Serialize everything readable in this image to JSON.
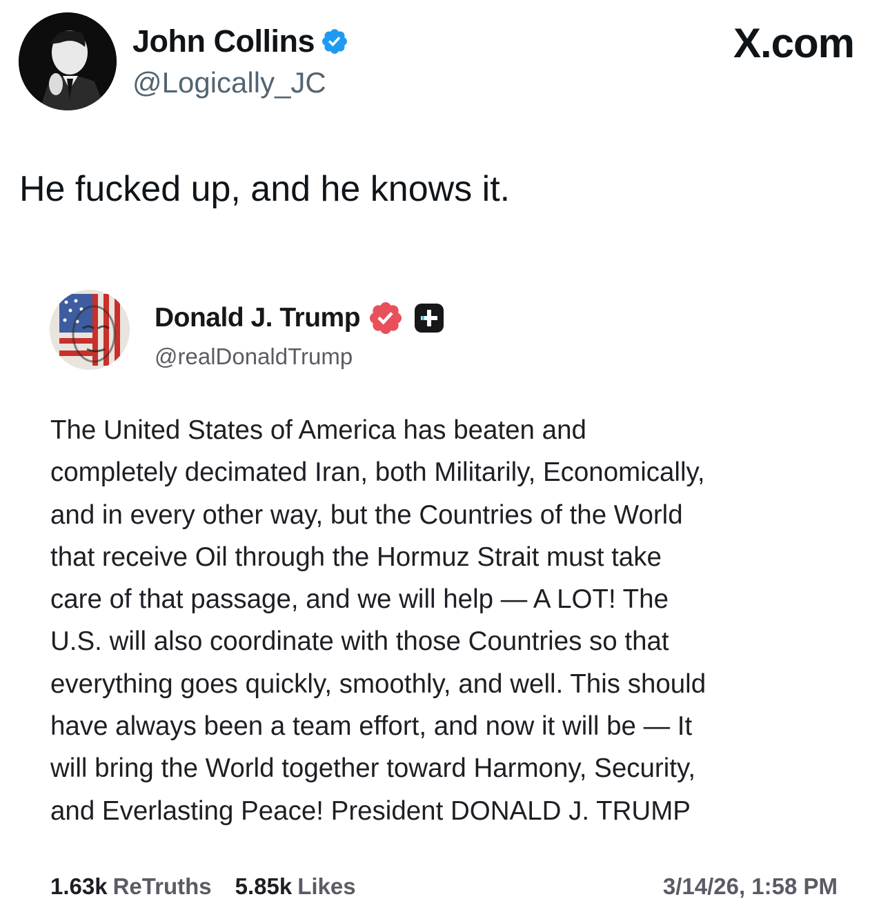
{
  "post": {
    "author_name": "John Collins",
    "author_handle": "@Logically_JC",
    "brand": "X.com",
    "text": "He fucked up, and he knows it."
  },
  "embedded": {
    "author_name": "Donald J. Trump",
    "author_handle": "@realDonaldTrump",
    "body_lines": [
      "The United States of America has beaten and",
      "completely decimated Iran, both Militarily, Economically,",
      "and in every other way, but the Countries of the World",
      "that receive Oil through the Hormuz Strait must take",
      "care of that passage, and we will help — A LOT! The",
      "U.S. will also coordinate with those Countries so that",
      "everything goes quickly, smoothly, and well. This should",
      "have always been a team effort, and now it will be — It",
      "will bring the World together toward Harmony, Security,",
      "and Everlasting Peace! President DONALD J. TRUMP"
    ],
    "retruths_count": "1.63k",
    "retruths_label": "ReTruths",
    "likes_count": "5.85k",
    "likes_label": "Likes",
    "timestamp": "3/14/26, 1:58 PM"
  },
  "icons": {
    "verified_x": "verified-badge-icon",
    "verified_truth": "verified-badge-icon",
    "plus_badge": "plus-badge-icon"
  },
  "colors": {
    "x_verified": "#1d9bf0",
    "truth_verified": "#e8505b",
    "text_primary": "#0f1419",
    "text_secondary": "#536471"
  }
}
